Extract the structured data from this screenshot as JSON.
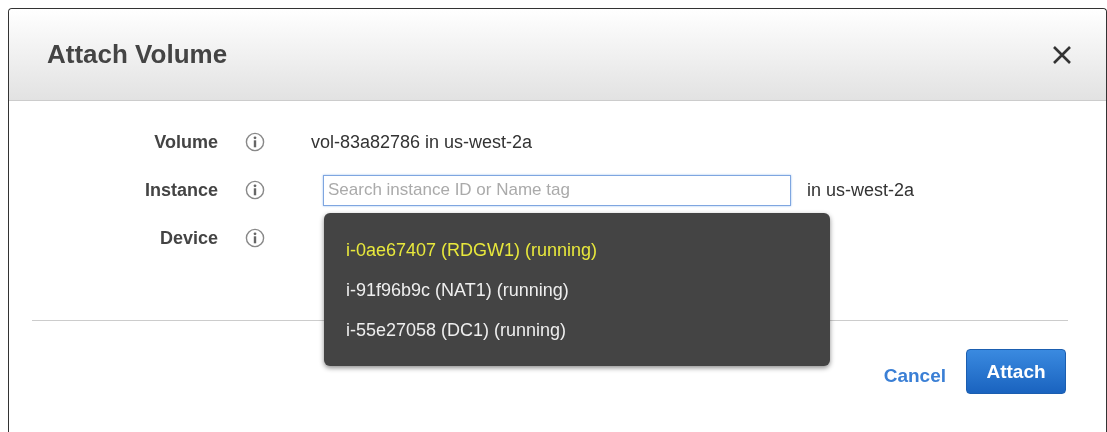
{
  "dialog": {
    "title": "Attach Volume"
  },
  "fields": [
    {
      "label": "Volume",
      "kind": "text",
      "value": "vol-83a82786 in us-west-2a"
    },
    {
      "label": "Instance",
      "kind": "search",
      "placeholder": "Search instance ID or Name tag",
      "suffix": "in us-west-2a"
    },
    {
      "label": "Device",
      "kind": "covered"
    }
  ],
  "dropdown": {
    "items": [
      {
        "label": "i-0ae67407 (RDGW1) (running)",
        "selected": true
      },
      {
        "label": "i-91f96b9c (NAT1) (running)",
        "selected": false
      },
      {
        "label": "i-55e27058 (DC1) (running)",
        "selected": false
      }
    ]
  },
  "buttons": {
    "cancel": "Cancel",
    "attach": "Attach"
  }
}
